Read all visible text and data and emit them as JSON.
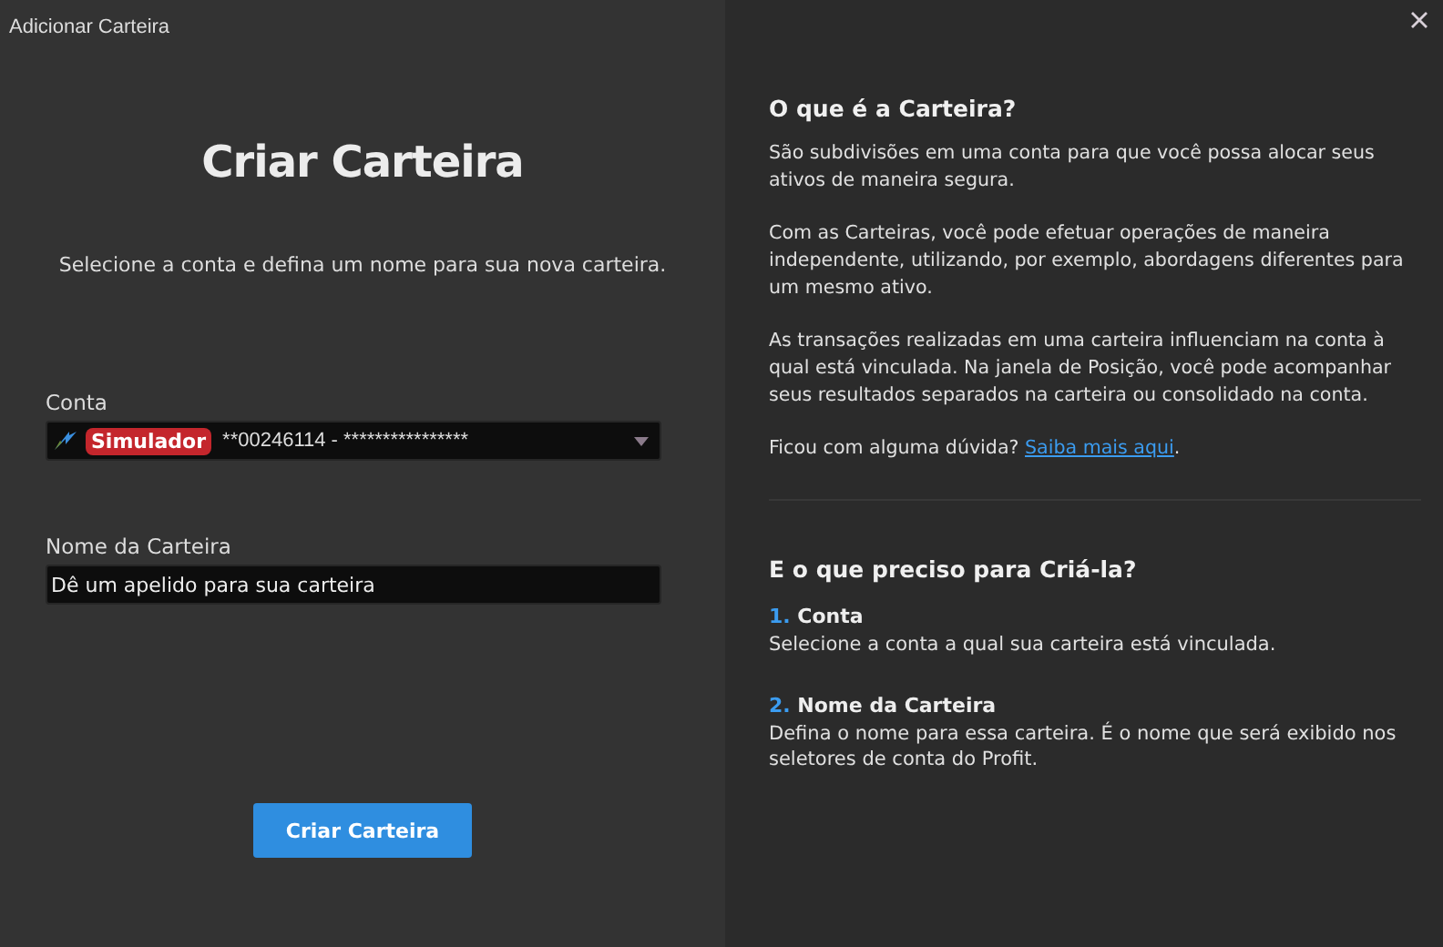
{
  "window": {
    "title": "Adicionar Carteira"
  },
  "form": {
    "heading": "Criar Carteira",
    "subtitle": "Selecione a conta e defina um nome para sua nova carteira.",
    "account": {
      "label": "Conta",
      "badge": "Simulador",
      "value": "**00246114 - ****************"
    },
    "name": {
      "label": "Nome da Carteira",
      "placeholder": "Dê um apelido para sua carteira"
    },
    "submit": "Criar Carteira"
  },
  "info": {
    "title": "O que é a Carteira?",
    "paragraphs": [
      "São subdivisões em uma conta para que você possa alocar seus ativos de maneira segura.",
      "Com as Carteiras, você pode efetuar operações de maneira independente, utilizando, por exemplo, abordagens diferentes para um mesmo ativo.",
      "As transações realizadas em uma carteira influenciam na conta à qual está vinculada. Na janela de Posição, você pode acompanhar seus resultados separados na carteira ou consolidado na conta."
    ],
    "question": {
      "text": "Ficou com alguma dúvida?",
      "link": "Saiba mais aqui",
      "end": "."
    }
  },
  "requirements": {
    "title": "E o que preciso para Criá-la?",
    "steps": [
      {
        "number": "1.",
        "title": "Conta",
        "text": "Selecione a conta a qual sua carteira está vinculada."
      },
      {
        "number": "2.",
        "title": "Nome da Carteira",
        "text": "Defina o nome para essa carteira. É o nome que será exibido nos seletores de conta do Profit."
      }
    ]
  }
}
